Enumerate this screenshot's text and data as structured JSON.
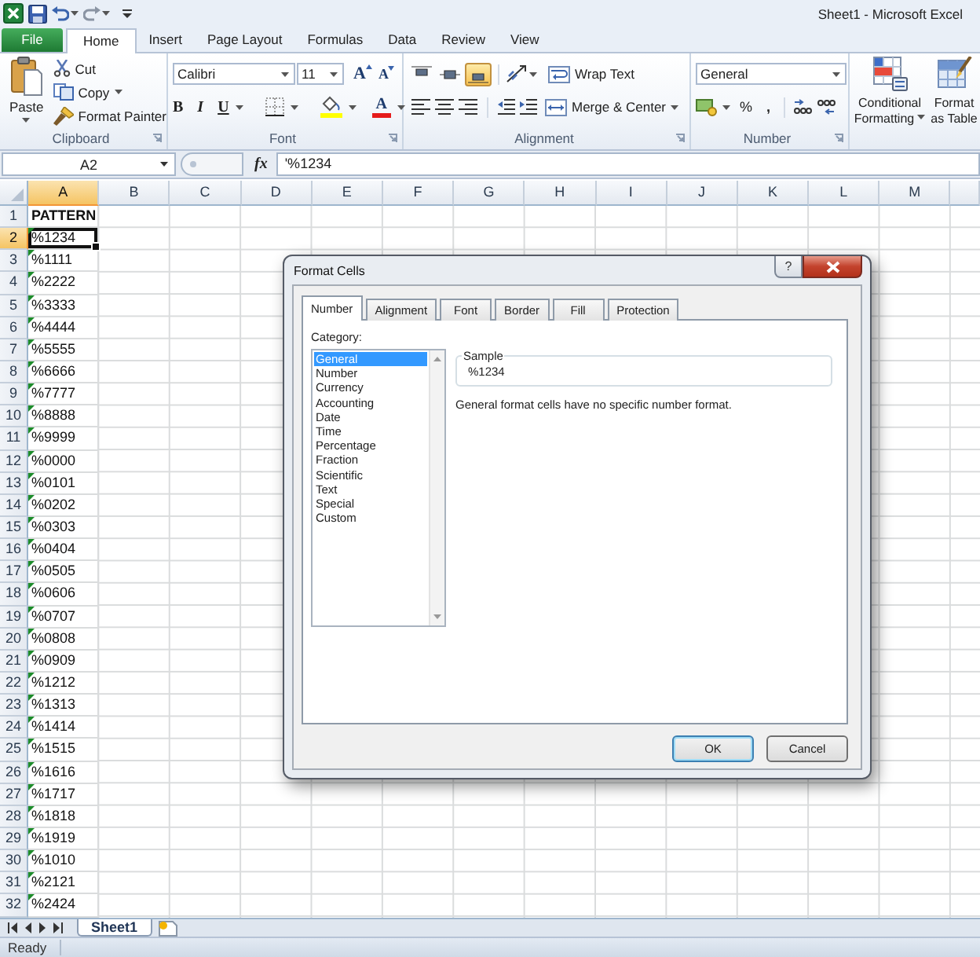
{
  "window": {
    "title": "Sheet1 - Microsoft Excel"
  },
  "ribbon_tabs": [
    {
      "label": "File",
      "kind": "file",
      "selected": false
    },
    {
      "label": "Home",
      "kind": "tab",
      "selected": true
    },
    {
      "label": "Insert",
      "kind": "tab",
      "selected": false
    },
    {
      "label": "Page Layout",
      "kind": "tab",
      "selected": false
    },
    {
      "label": "Formulas",
      "kind": "tab",
      "selected": false
    },
    {
      "label": "Data",
      "kind": "tab",
      "selected": false
    },
    {
      "label": "Review",
      "kind": "tab",
      "selected": false
    },
    {
      "label": "View",
      "kind": "tab",
      "selected": false
    }
  ],
  "clipboard": {
    "label": "Clipboard",
    "paste": "Paste",
    "cut": "Cut",
    "copy": "Copy",
    "format_painter": "Format Painter"
  },
  "font": {
    "label": "Font",
    "font_name": "Calibri",
    "font_size": "11",
    "grow": "A",
    "shrink": "A",
    "bold": "B",
    "italic": "I",
    "underline": "U",
    "font_color": "A"
  },
  "alignment": {
    "label": "Alignment",
    "vertical": [
      {
        "selected": false
      },
      {
        "selected": false
      },
      {
        "selected": true
      }
    ],
    "wrap_text": "Wrap Text",
    "merge_center": "Merge & Center"
  },
  "number": {
    "label": "Number",
    "format": "General",
    "percent": "%",
    "comma": ","
  },
  "styles": {
    "conditional_formatting": [
      "Conditional",
      "Formatting"
    ],
    "format_as_table": [
      "Format",
      "as Table"
    ]
  },
  "formula_bar": {
    "name_box": "A2",
    "function": "fx",
    "formula": "'%1234"
  },
  "sheet": {
    "columns": [
      {
        "label": "A",
        "selected": true
      },
      {
        "label": "B",
        "selected": false
      },
      {
        "label": "C",
        "selected": false
      },
      {
        "label": "D",
        "selected": false
      },
      {
        "label": "E",
        "selected": false
      },
      {
        "label": "F",
        "selected": false
      },
      {
        "label": "G",
        "selected": false
      },
      {
        "label": "H",
        "selected": false
      },
      {
        "label": "I",
        "selected": false
      },
      {
        "label": "J",
        "selected": false
      },
      {
        "label": "K",
        "selected": false
      },
      {
        "label": "L",
        "selected": false
      },
      {
        "label": "M",
        "selected": false
      }
    ],
    "rows": [
      {
        "number": "1",
        "value": "PATTERN",
        "bold": true,
        "flagged": false,
        "selected": false
      },
      {
        "number": "2",
        "value": "%1234",
        "bold": false,
        "flagged": true,
        "selected": true
      },
      {
        "number": "3",
        "value": "%1111",
        "bold": false,
        "flagged": true,
        "selected": false
      },
      {
        "number": "4",
        "value": "%2222",
        "bold": false,
        "flagged": true,
        "selected": false
      },
      {
        "number": "5",
        "value": "%3333",
        "bold": false,
        "flagged": true,
        "selected": false
      },
      {
        "number": "6",
        "value": "%4444",
        "bold": false,
        "flagged": true,
        "selected": false
      },
      {
        "number": "7",
        "value": "%5555",
        "bold": false,
        "flagged": true,
        "selected": false
      },
      {
        "number": "8",
        "value": "%6666",
        "bold": false,
        "flagged": true,
        "selected": false
      },
      {
        "number": "9",
        "value": "%7777",
        "bold": false,
        "flagged": true,
        "selected": false
      },
      {
        "number": "10",
        "value": "%8888",
        "bold": false,
        "flagged": true,
        "selected": false
      },
      {
        "number": "11",
        "value": "%9999",
        "bold": false,
        "flagged": true,
        "selected": false
      },
      {
        "number": "12",
        "value": "%0000",
        "bold": false,
        "flagged": true,
        "selected": false
      },
      {
        "number": "13",
        "value": "%0101",
        "bold": false,
        "flagged": true,
        "selected": false
      },
      {
        "number": "14",
        "value": "%0202",
        "bold": false,
        "flagged": true,
        "selected": false
      },
      {
        "number": "15",
        "value": "%0303",
        "bold": false,
        "flagged": true,
        "selected": false
      },
      {
        "number": "16",
        "value": "%0404",
        "bold": false,
        "flagged": true,
        "selected": false
      },
      {
        "number": "17",
        "value": "%0505",
        "bold": false,
        "flagged": true,
        "selected": false
      },
      {
        "number": "18",
        "value": "%0606",
        "bold": false,
        "flagged": true,
        "selected": false
      },
      {
        "number": "19",
        "value": "%0707",
        "bold": false,
        "flagged": true,
        "selected": false
      },
      {
        "number": "20",
        "value": "%0808",
        "bold": false,
        "flagged": true,
        "selected": false
      },
      {
        "number": "21",
        "value": "%0909",
        "bold": false,
        "flagged": true,
        "selected": false
      },
      {
        "number": "22",
        "value": "%1212",
        "bold": false,
        "flagged": true,
        "selected": false
      },
      {
        "number": "23",
        "value": "%1313",
        "bold": false,
        "flagged": true,
        "selected": false
      },
      {
        "number": "24",
        "value": "%1414",
        "bold": false,
        "flagged": true,
        "selected": false
      },
      {
        "number": "25",
        "value": "%1515",
        "bold": false,
        "flagged": true,
        "selected": false
      },
      {
        "number": "26",
        "value": "%1616",
        "bold": false,
        "flagged": true,
        "selected": false
      },
      {
        "number": "27",
        "value": "%1717",
        "bold": false,
        "flagged": true,
        "selected": false
      },
      {
        "number": "28",
        "value": "%1818",
        "bold": false,
        "flagged": true,
        "selected": false
      },
      {
        "number": "29",
        "value": "%1919",
        "bold": false,
        "flagged": true,
        "selected": false
      },
      {
        "number": "30",
        "value": "%1010",
        "bold": false,
        "flagged": true,
        "selected": false
      },
      {
        "number": "31",
        "value": "%2121",
        "bold": false,
        "flagged": true,
        "selected": false
      },
      {
        "number": "32",
        "value": "%2424",
        "bold": false,
        "flagged": true,
        "selected": false
      }
    ]
  },
  "sheet_tabs": [
    {
      "label": "Sheet1",
      "selected": true
    }
  ],
  "status_bar": {
    "text": "Ready"
  },
  "dialog": {
    "title": "Format Cells",
    "help": "?",
    "tabs": [
      {
        "label": "Number",
        "selected": true
      },
      {
        "label": "Alignment",
        "selected": false
      },
      {
        "label": "Font",
        "selected": false
      },
      {
        "label": "Border",
        "selected": false
      },
      {
        "label": "Fill",
        "selected": false
      },
      {
        "label": "Protection",
        "selected": false
      }
    ],
    "category_label": "Category:",
    "categories": [
      {
        "label": "General",
        "selected": true
      },
      {
        "label": "Number",
        "selected": false
      },
      {
        "label": "Currency",
        "selected": false
      },
      {
        "label": "Accounting",
        "selected": false
      },
      {
        "label": "Date",
        "selected": false
      },
      {
        "label": "Time",
        "selected": false
      },
      {
        "label": "Percentage",
        "selected": false
      },
      {
        "label": "Fraction",
        "selected": false
      },
      {
        "label": "Scientific",
        "selected": false
      },
      {
        "label": "Text",
        "selected": false
      },
      {
        "label": "Special",
        "selected": false
      },
      {
        "label": "Custom",
        "selected": false
      }
    ],
    "sample_label": "Sample",
    "sample_value": "%1234",
    "description": "General format cells have no specific number format.",
    "buttons": [
      {
        "label": "OK",
        "kind": "default"
      },
      {
        "label": "Cancel",
        "kind": "normal"
      }
    ]
  }
}
